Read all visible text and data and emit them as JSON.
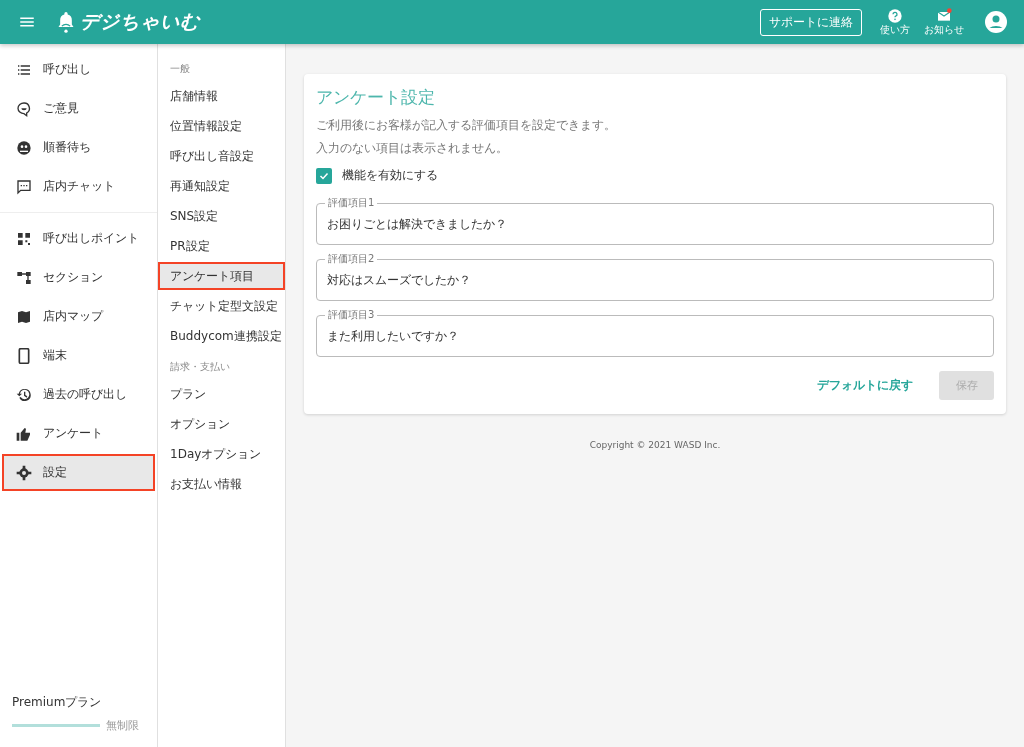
{
  "header": {
    "logo": "デジちゃいむ",
    "support_button": "サポートに連絡",
    "help": "使い方",
    "notifications": {
      "label": "お知らせ",
      "unread": true
    }
  },
  "sidebar": {
    "groups": [
      [
        {
          "label": "呼び出し",
          "selected": false
        },
        {
          "label": "ご意見",
          "selected": false
        },
        {
          "label": "順番待ち",
          "selected": false
        },
        {
          "label": "店内チャット",
          "selected": false
        }
      ],
      [
        {
          "label": "呼び出しポイント",
          "selected": false
        },
        {
          "label": "セクション",
          "selected": false
        },
        {
          "label": "店内マップ",
          "selected": false
        },
        {
          "label": "端末",
          "selected": false
        },
        {
          "label": "過去の呼び出し",
          "selected": false
        },
        {
          "label": "アンケート",
          "selected": false
        },
        {
          "label": "設定",
          "selected": true
        }
      ]
    ],
    "plan": {
      "name": "Premiumプラン",
      "level": 1,
      "limit": "無制限"
    }
  },
  "subnav": {
    "sections": [
      {
        "heading": "一般",
        "items": [
          {
            "label": "店舗情報",
            "selected": false
          },
          {
            "label": "位置情報設定",
            "selected": false
          },
          {
            "label": "呼び出し音設定",
            "selected": false
          },
          {
            "label": "再通知設定",
            "selected": false
          },
          {
            "label": "SNS設定",
            "selected": false
          },
          {
            "label": "PR設定",
            "selected": false
          },
          {
            "label": "アンケート項目",
            "selected": true
          },
          {
            "label": "チャット定型文設定",
            "selected": false
          },
          {
            "label": "Buddycom連携設定",
            "selected": false
          }
        ]
      },
      {
        "heading": "請求・支払い",
        "items": [
          {
            "label": "プラン",
            "selected": false
          },
          {
            "label": "オプション",
            "selected": false
          },
          {
            "label": "1Dayオプション",
            "selected": false
          },
          {
            "label": "お支払い情報",
            "selected": false
          }
        ]
      }
    ]
  },
  "card": {
    "title": "アンケート設定",
    "description": [
      "ご利用後にお客様が記入する評価項目を設定できます。",
      "入力のない項目は表示されません。"
    ],
    "enable": {
      "label": "機能を有効にする",
      "checked": true
    },
    "fields": [
      {
        "label": "評価項目1",
        "value": "お困りごとは解決できましたか？"
      },
      {
        "label": "評価項目2",
        "value": "対応はスムーズでしたか？"
      },
      {
        "label": "評価項目3",
        "value": "また利用したいですか？"
      }
    ],
    "reset_button": "デフォルトに戻す",
    "save_button": {
      "label": "保存",
      "disabled": true
    }
  },
  "footer": "Copyright © 2021 WASD Inc."
}
